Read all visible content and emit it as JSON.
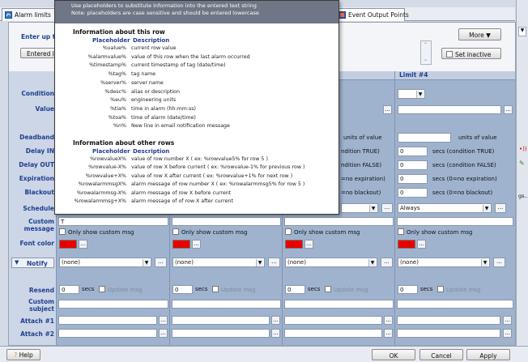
{
  "tabs": {
    "alarm_limits": "Alarm limits",
    "event_output_points": "Event Output Points"
  },
  "top": {
    "enter_up_to": "Enter up to",
    "entered_lim": "Entered lim",
    "more": "More",
    "set_inactive": "Set inactive"
  },
  "labels": {
    "condition": "Condition",
    "value": "Value",
    "deadband": "Deadband",
    "delay_in": "Delay IN",
    "delay_out": "Delay OUT",
    "expiration": "Expiration",
    "blackout": "Blackout",
    "schedule": "Schedule",
    "custom_message": "Custom message",
    "font_color": "Font color",
    "notify": "Notify",
    "resend": "Resend",
    "custom_subject": "Custom subject",
    "attach1": "Attach #1",
    "attach2": "Attach #2"
  },
  "limit4": {
    "header": "Limit #4",
    "deadband_units": "units of value",
    "delay_in": "0",
    "delay_in_unit": "secs (condition TRUE)",
    "delay_out": "0",
    "delay_out_unit": "secs (condition FALSE)",
    "expiration": "0",
    "expiration_unit": "secs (0=no expiration)",
    "blackout": "0",
    "blackout_unit": "secs (0=no blackout)",
    "schedule": "Always"
  },
  "limit3": {
    "deadband_units": "units of value",
    "delay_in_unit": "ndition TRUE)",
    "delay_out_unit": "ndition FALSE)",
    "expiration_unit": "=no expiration)",
    "blackout_unit": "=no blackout)"
  },
  "col1": {
    "custom_message": "T"
  },
  "common": {
    "only_show_custom": "Only show custom msg",
    "notify_none": "(none)",
    "resend_value": "0",
    "secs": "secs",
    "update_msg": "Update msg",
    "dots": "..."
  },
  "tooltip": {
    "line1": "Use placeholders to substitute information into the entered text string",
    "line2": "Note: placeholders are case sensitive and should be entered lowercase",
    "sec1": "Information about this row",
    "sec2": "Information about other rows",
    "col_placeholder": "Placeholder",
    "col_description": "Description",
    "rows1": [
      {
        "k": "%value%",
        "v": "current row value"
      },
      {
        "k": "%alarmvalue%",
        "v": "value of this row when the last alarm occurred"
      },
      {
        "k": "%timestamp%",
        "v": "current timestamp of tag (date/time)"
      },
      {
        "k": "%tag%",
        "v": "tag name"
      },
      {
        "k": "%server%",
        "v": "server name"
      },
      {
        "k": "%desc%",
        "v": "alias or description"
      },
      {
        "k": "%eu%",
        "v": "engineering units"
      },
      {
        "k": "%tia%",
        "v": "time in alarm (hh:mm:ss)"
      },
      {
        "k": "%toa%",
        "v": "time of alarm (date/time)"
      },
      {
        "k": "%n%",
        "v": "New line in email notification message"
      }
    ],
    "rows2": [
      {
        "k": "%rowvalueX%",
        "v": "value of row number X ( ex: %rowvalue5% for row 5 )"
      },
      {
        "k": "%rowvalue-X%",
        "v": "value of row X before current ( ex: %rowvalue-1% for previous row )"
      },
      {
        "k": "%rowvalue+X%",
        "v": "value of row X after current ( ex: %rowvalue+1% for next row )"
      },
      {
        "k": "%rowalarmmsgX%",
        "v": "alarm message of row number X ( ex: %rowalarmmsg5% for row 5 )"
      },
      {
        "k": "%rowalarmmsg-X%",
        "v": "alarm message of row X before current"
      },
      {
        "k": "%rowalarmmsg+X%",
        "v": "alarm message of of row X after current"
      }
    ]
  },
  "bottom": {
    "help": "Help",
    "ok": "OK",
    "cancel": "Cancel",
    "apply": "Apply"
  },
  "side": {
    "gs": "gs..."
  },
  "colors": {
    "accent": "#1f3f8f",
    "font_color_swatch": "#e60000"
  }
}
